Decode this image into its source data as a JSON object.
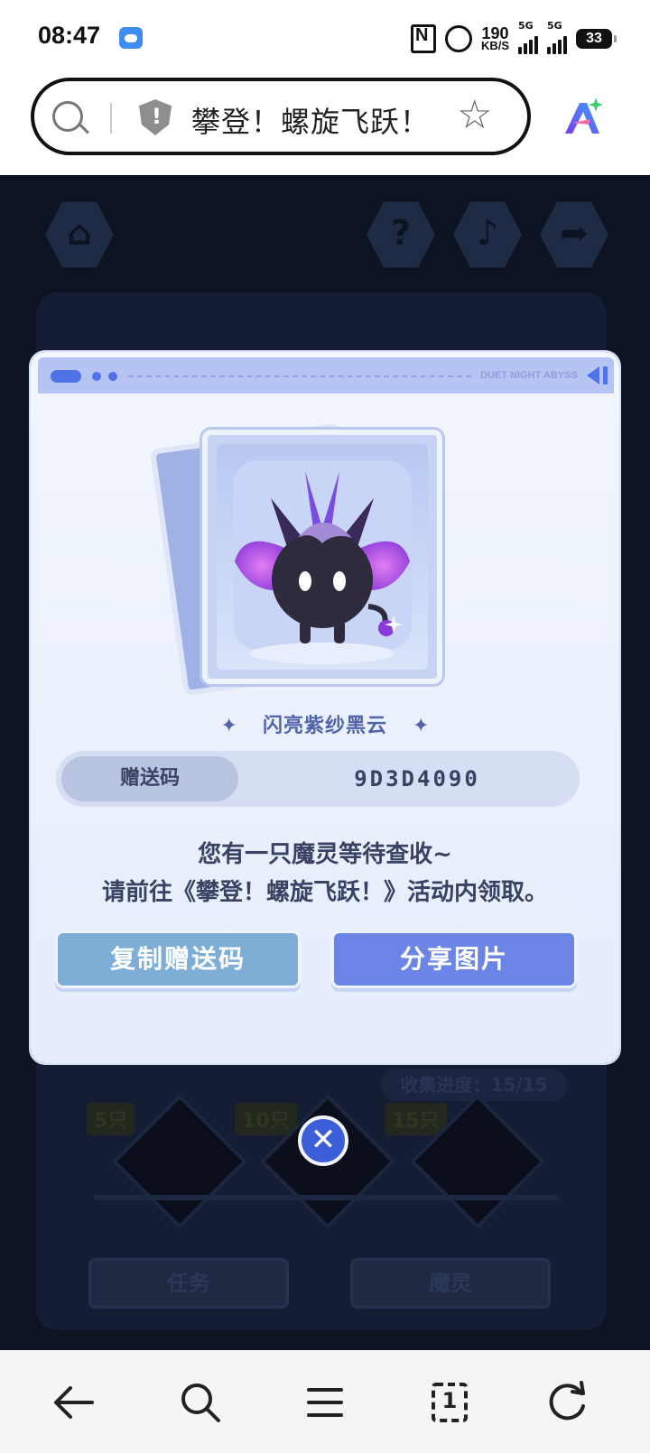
{
  "status_bar": {
    "time": "08:47",
    "speed_value": "190",
    "speed_unit": "KB/S",
    "signal1_label": "5G",
    "signal2_label": "5G",
    "battery": "33"
  },
  "address_bar": {
    "page_title": "攀登！螺旋飞跃！"
  },
  "game_background": {
    "progress_text": "收集进度：15/15",
    "milestones": [
      "5只",
      "10只",
      "15只"
    ],
    "tab_tasks": "任务",
    "tab_spirits": "魔灵"
  },
  "modal": {
    "header_brand": "DUET NIGHT ABYSS",
    "pet_name": "闪亮紫纱黑云",
    "gift_code_label": "赠送码",
    "gift_code_value": "9D3D4090",
    "message_line1": "您有一只魔灵等待查收~",
    "message_line2": "请前往《攀登！螺旋飞跃！》活动内领取。",
    "copy_button": "复制赠送码",
    "share_button": "分享图片"
  },
  "bottom_nav": {
    "tabs_count": "1"
  },
  "colors": {
    "accent_blue": "#6a85e6",
    "copy_button": "#7eaed6",
    "header_band": "#b5c4f3",
    "game_bg": "#0c1322"
  }
}
